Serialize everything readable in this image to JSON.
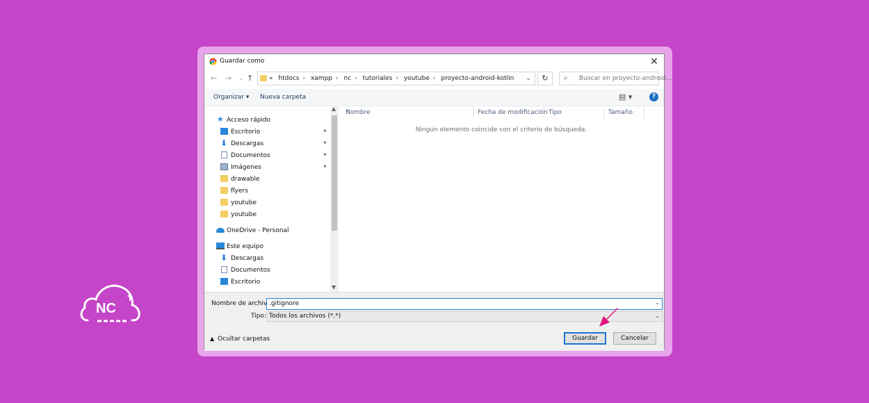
{
  "dialog": {
    "title": "Guardar como",
    "close_symbol": "✕"
  },
  "nav": {
    "back_symbol": "←",
    "forward_symbol": "→",
    "recent_symbol": "⌄",
    "up_symbol": "↑",
    "breadcrumb": [
      "«",
      "htdocs",
      "xampp",
      "nc",
      "tutoriales",
      "youtube",
      "proyecto-android-kotlin"
    ],
    "refresh_symbol": "↻",
    "search_placeholder": "Buscar en proyecto-android..."
  },
  "toolbar": {
    "organize": "Organizar ▾",
    "new_folder": "Nueva carpeta",
    "view_symbol": "▤ ▾",
    "help_symbol": "?"
  },
  "sidebar": {
    "items": [
      {
        "label": "Acceso rápido",
        "icon": "star-icon",
        "pinned": false
      },
      {
        "label": "Escritorio",
        "icon": "desktop-icon",
        "pinned": true
      },
      {
        "label": "Descargas",
        "icon": "download-icon",
        "pinned": true
      },
      {
        "label": "Documentos",
        "icon": "document-icon",
        "pinned": true
      },
      {
        "label": "Imágenes",
        "icon": "pictures-icon",
        "pinned": true
      },
      {
        "label": "drawable",
        "icon": "folder-icon",
        "pinned": false
      },
      {
        "label": "flyers",
        "icon": "folder-icon",
        "pinned": false
      },
      {
        "label": "youtube",
        "icon": "folder-icon",
        "pinned": false
      },
      {
        "label": "youtube",
        "icon": "folder-icon",
        "pinned": false
      },
      {
        "label": "OneDrive - Personal",
        "icon": "cloud-icon",
        "pinned": false
      },
      {
        "label": "Este equipo",
        "icon": "computer-icon",
        "pinned": false
      },
      {
        "label": "Descargas",
        "icon": "download-icon",
        "pinned": false
      },
      {
        "label": "Documentos",
        "icon": "document-icon",
        "pinned": false
      },
      {
        "label": "Escritorio",
        "icon": "desktop-icon",
        "pinned": false
      }
    ],
    "pin_symbol": "📌"
  },
  "files": {
    "columns": [
      "Nombre",
      "Fecha de modificación",
      "Tipo",
      "Tamaño"
    ],
    "empty_message": "Ningún elemento coincide con el criterio de búsqueda."
  },
  "form": {
    "filename_label": "Nombre de archivo:",
    "filename_value": ".gitignore",
    "type_label": "Tipo:",
    "type_value": "Todos los archivos (*.*)",
    "hide_folders": "Ocultar carpetas",
    "save_label": "Guardar",
    "cancel_label": "Cancelar"
  },
  "logo": {
    "text": "NC"
  },
  "colors": {
    "background": "#c545c8",
    "frame": "#e7a4ea",
    "arrow": "#e0157e",
    "accent": "#1a74d2"
  }
}
